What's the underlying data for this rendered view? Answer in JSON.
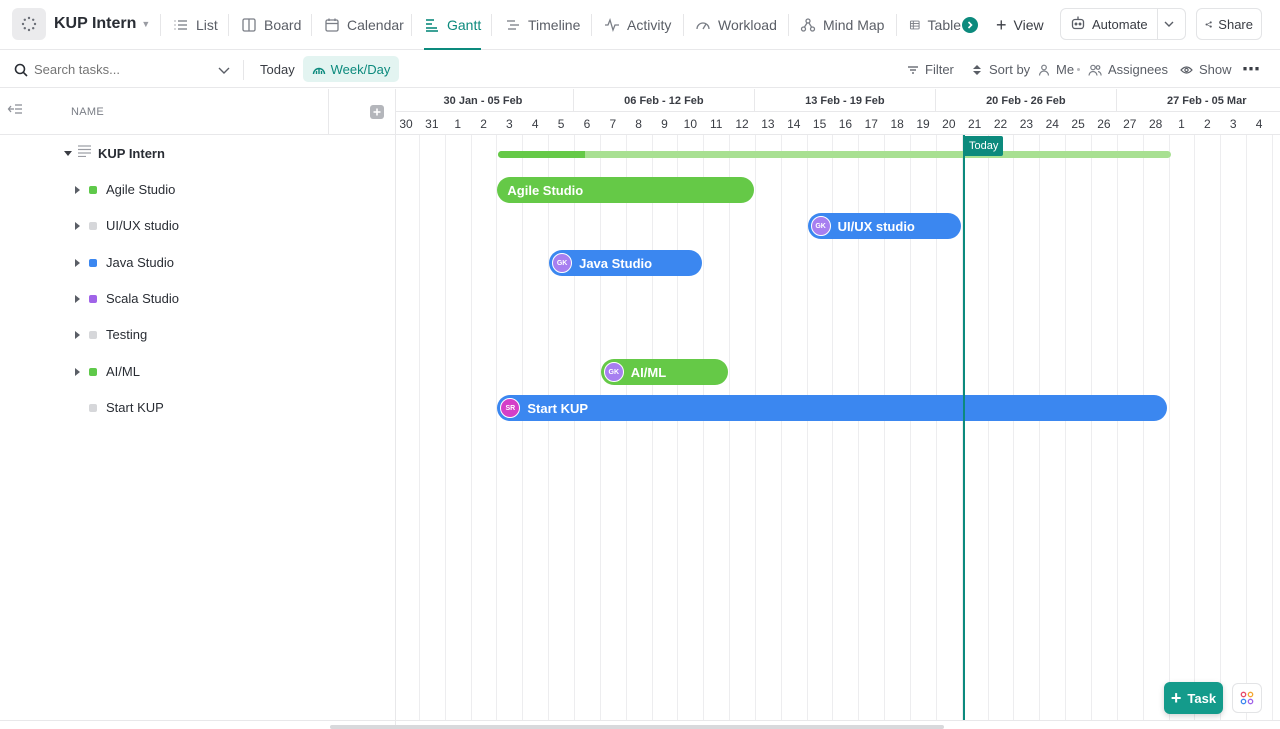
{
  "header": {
    "project_title": "KUP Intern",
    "tabs": [
      {
        "label": "List",
        "icon": "list-icon"
      },
      {
        "label": "Board",
        "icon": "board-icon"
      },
      {
        "label": "Calendar",
        "icon": "calendar-icon"
      },
      {
        "label": "Gantt",
        "icon": "gantt-icon",
        "active": true
      },
      {
        "label": "Timeline",
        "icon": "timeline-icon"
      },
      {
        "label": "Activity",
        "icon": "activity-icon"
      },
      {
        "label": "Workload",
        "icon": "workload-icon"
      },
      {
        "label": "Mind Map",
        "icon": "mindmap-icon"
      },
      {
        "label": "Table",
        "icon": "table-icon"
      }
    ],
    "add_view_label": "View",
    "automate_label": "Automate",
    "share_label": "Share"
  },
  "toolbar": {
    "search_placeholder": "Search tasks...",
    "today_label": "Today",
    "weekday_label": "Week/Day",
    "filter_label": "Filter",
    "sort_label": "Sort by",
    "me_label": "Me",
    "assignees_label": "Assignees",
    "show_label": "Show"
  },
  "left_panel": {
    "name_header": "NAME",
    "root": "KUP Intern",
    "tasks": [
      {
        "label": "Agile Studio",
        "color": "#5fc94a",
        "expandable": true
      },
      {
        "label": "UI/UX studio",
        "color": "#d6d7da",
        "expandable": true
      },
      {
        "label": "Java Studio",
        "color": "#3b87f0",
        "expandable": true
      },
      {
        "label": "Scala Studio",
        "color": "#a063e8",
        "expandable": true
      },
      {
        "label": "Testing",
        "color": "#d6d7da",
        "expandable": true
      },
      {
        "label": "AI/ML",
        "color": "#5fc94a",
        "expandable": true
      },
      {
        "label": "Start KUP",
        "color": "#d6d7da",
        "expandable": false
      }
    ]
  },
  "gantt": {
    "weeks": [
      "30 Jan - 05 Feb",
      "06 Feb - 12 Feb",
      "13 Feb - 19 Feb",
      "20 Feb - 26 Feb",
      "27 Feb - 05 Mar"
    ],
    "days": [
      "30",
      "31",
      "1",
      "2",
      "3",
      "4",
      "5",
      "6",
      "7",
      "8",
      "9",
      "10",
      "11",
      "12",
      "13",
      "14",
      "15",
      "16",
      "17",
      "18",
      "19",
      "20",
      "21",
      "22",
      "23",
      "24",
      "25",
      "26",
      "27",
      "28",
      "1",
      "2",
      "3",
      "4"
    ],
    "today_label": "Today",
    "today_day": "21",
    "summary_progress_pct": 13,
    "bars": [
      {
        "label": "Agile Studio",
        "color": "#65c947",
        "start": "3",
        "end": "12",
        "avatar": ""
      },
      {
        "label": "UI/UX studio",
        "color": "#3b87f0",
        "start": "15",
        "end": "20",
        "avatar": "GK",
        "avatar_color": "#a77ff0"
      },
      {
        "label": "Java Studio",
        "color": "#3b87f0",
        "start": "5",
        "end": "10",
        "avatar": "GK",
        "avatar_color": "#a77ff0"
      },
      {
        "label": "AI/ML",
        "color": "#65c947",
        "start": "7",
        "end": "11",
        "avatar": "GK",
        "avatar_color": "#a77ff0"
      },
      {
        "label": "Start KUP",
        "color": "#3b87f0",
        "start": "3",
        "end": "28",
        "avatar": "SR",
        "avatar_color": "#d43fc8"
      }
    ]
  },
  "fab": {
    "task_label": "Task"
  }
}
